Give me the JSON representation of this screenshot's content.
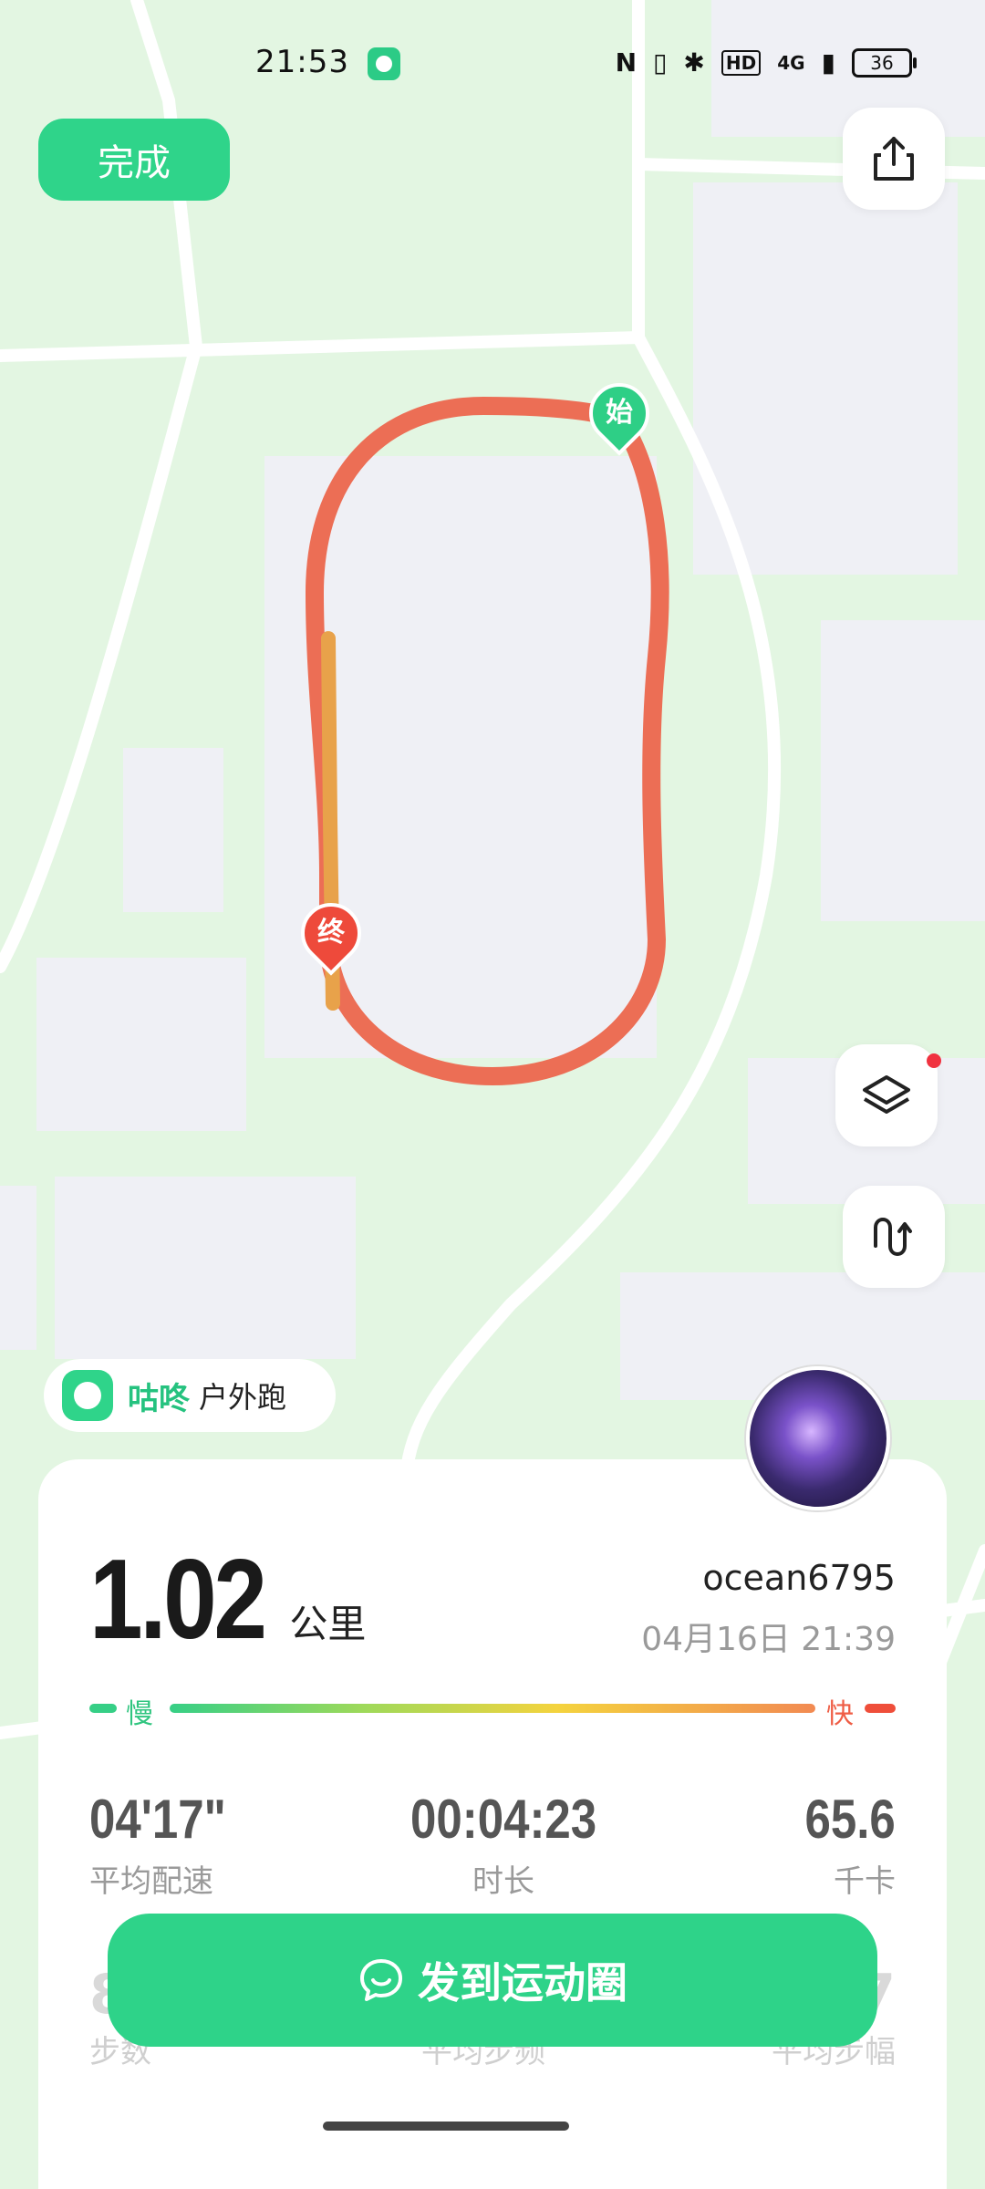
{
  "status_bar": {
    "time": "21:53",
    "network": "4G",
    "battery": "36",
    "hd_label": "HD"
  },
  "top": {
    "done_label": "完成"
  },
  "map": {
    "start_marker_label": "始",
    "end_marker_label": "终",
    "route_color": "#ec6e55"
  },
  "brand": {
    "name": "咕咚",
    "sport": "户外跑"
  },
  "summary": {
    "distance": "1.02",
    "distance_unit": "公里",
    "username": "ocean6795",
    "datetime": "04月16日 21:39",
    "pace_slow_label": "慢",
    "pace_fast_label": "快"
  },
  "stats": {
    "pace_value": "04'17\"",
    "pace_label": "平均配速",
    "duration_value": "00:04:23",
    "duration_label": "时长",
    "calories_value": "65.6",
    "calories_label": "千卡"
  },
  "stats_hidden": {
    "steps_value_partial": "8",
    "steps_label": "步数",
    "cadence_label": "平均步频",
    "stride_value_partial": "7",
    "stride_label": "平均步幅"
  },
  "actions": {
    "post_label": "发到运动圈"
  },
  "colors": {
    "accent": "#2ed389",
    "map_bg": "#e3f6e2",
    "fast": "#ef4e3a"
  }
}
